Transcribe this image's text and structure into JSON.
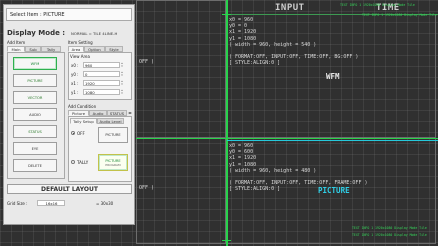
{
  "panel": {
    "select_item": "Select Item : PICTURE",
    "display_mode_label": "Display Mode :",
    "display_mode_value": "NORMAL = TILE 4LINE-H",
    "add_item_label": "Add Item",
    "item_setting_label": "Item Setting",
    "left_tabs": [
      "Main",
      "Sub",
      "Tally"
    ],
    "item_buttons": [
      "WFM",
      "PICTURE",
      "VECTOR",
      "AUDIO",
      "STATUS",
      "EYE",
      "DELETE"
    ],
    "setting_tabs": [
      "Area",
      "Option",
      "Style"
    ],
    "view_area_label": "View Area",
    "fields": [
      {
        "label": "x0 :",
        "value": "960"
      },
      {
        "label": "y0 :",
        "value": "0"
      },
      {
        "label": "x1 :",
        "value": "1920"
      },
      {
        "label": "y1 :",
        "value": "1080"
      }
    ],
    "add_condition_label": "Add Condition",
    "condition_tabs": [
      "Picture",
      "Audio",
      "STATUS"
    ],
    "tally_tabs": [
      "Tally Setup",
      "Audio Level"
    ],
    "condition_options": [
      "OFF",
      "TALLY"
    ],
    "cond_buttons": {
      "off": "PICTURE",
      "tally": "PICTURE"
    },
    "cond_tally_sub": "PROGRAM",
    "default_layout": "DEFAULT LAYOUT",
    "grid_size_label": "Grid Size :",
    "grid_size_value": "16x16",
    "grid_size_value2": "= 30x30"
  },
  "canvas": {
    "top_titles": [
      "INPUT",
      "TIME"
    ],
    "green_info": "TEXT INFO 1 1920x1080 Display Mode Tile",
    "top_block": [
      "x0 = 960",
      "y0 = 0",
      "x1 = 1920",
      "y1 = 1080",
      "( width = 960, height = 540 )",
      "",
      "( FORMAT:OFF, INPUT:OFF, TIME:OFF, BG:OFF )",
      "[ STYLE:ALIGN:0 ]"
    ],
    "top_label": "WFM",
    "bottom_block": [
      "x0 = 960",
      "y0 = 600",
      "x1 = 1920",
      "y1 = 1080",
      "( width = 960, height = 480 )",
      "",
      "( FORMAT:OFF, INPUT:OFF, TIME:OFF, FRAME:OFF )",
      "[ STYLE:ALIGN:0 ]"
    ],
    "bottom_label": "PICTURE",
    "stub_top": "OFF )",
    "stub_bottom": "OFF )",
    "colors": {
      "wfm": "#e8e8e8",
      "picture": "#2fd0e8",
      "grid_line": "#27d34b"
    }
  }
}
